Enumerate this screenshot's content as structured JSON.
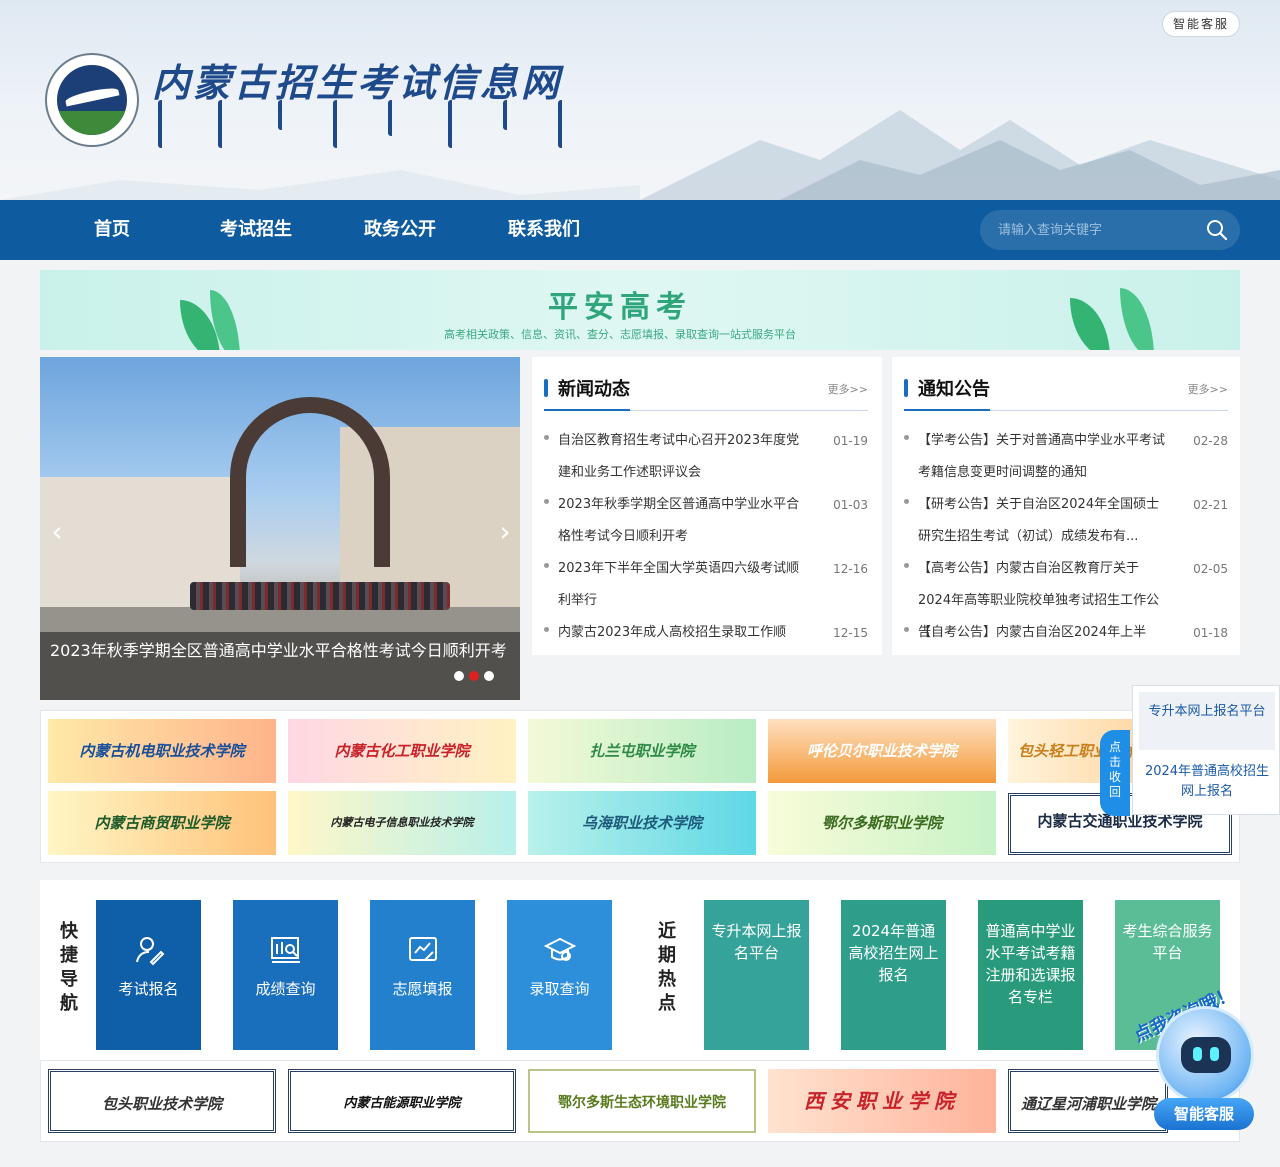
{
  "header": {
    "site_title": "内蒙古招生考试信息网",
    "service_button": "智能客服"
  },
  "nav": {
    "items": [
      {
        "label": "首页"
      },
      {
        "label": "考试招生"
      },
      {
        "label": "政务公开"
      },
      {
        "label": "联系我们"
      }
    ],
    "search_placeholder": "请输入查询关键字"
  },
  "banner": {
    "title": "平安高考",
    "subtitle": "高考相关政策、信息、资讯、查分、志愿填报、录取查询一站式服务平台"
  },
  "slider": {
    "caption": "2023年秋季学期全区普通高中学业水平合格性考试今日顺利开考",
    "prev": "‹",
    "next": "›",
    "active_dot": 2,
    "dot_count": 3
  },
  "news": {
    "title": "新闻动态",
    "more": "更多>>",
    "items": [
      {
        "text": "自治区教育招生考试中心召开2023年度党建和业务工作述职评议会",
        "date": "01-19"
      },
      {
        "text": "2023年秋季学期全区普通高中学业水平合格性考试今日顺利开考",
        "date": "01-03"
      },
      {
        "text": "2023年下半年全国大学英语四六级考试顺利举行",
        "date": "12-16"
      },
      {
        "text": "内蒙古2023年成人高校招生录取工作顺",
        "date": "12-15"
      }
    ]
  },
  "notices": {
    "title": "通知公告",
    "more": "更多>>",
    "items": [
      {
        "text": "【学考公告】关于对普通高中学业水平考试考籍信息变更时间调整的通知",
        "date": "02-28"
      },
      {
        "text": "【研考公告】关于自治区2024年全国硕士研究生招生考试（初试）成绩发布有...",
        "date": "02-21"
      },
      {
        "text": "【高考公告】内蒙古自治区教育厅关于2024年高等职业院校单独考试招生工作公告",
        "date": "02-05"
      },
      {
        "text": "【自考公告】内蒙古自治区2024年上半",
        "date": "01-18"
      }
    ]
  },
  "schools_row1": [
    {
      "name": "内蒙古机电职业技术学院",
      "color": "#1a4f9c"
    },
    {
      "name": "内蒙古化工职业学院",
      "color": "#c8222a"
    },
    {
      "name": "扎兰屯职业学院",
      "color": "#2f8a45"
    },
    {
      "name": "呼伦贝尔职业技术学院",
      "color": "#ffffff"
    },
    {
      "name": "包头轻工职业技术学院",
      "color": "#c9801e"
    }
  ],
  "schools_row2": [
    {
      "name": "内蒙古商贸职业学院",
      "color": "#1e5b2a"
    },
    {
      "name": "内蒙古电子信息职业技术学院",
      "color": "#222222"
    },
    {
      "name": "乌海职业技术学院",
      "color": "#1e5a7a"
    },
    {
      "name": "鄂尔多斯职业学院",
      "color": "#3a6b1e"
    },
    {
      "name": "内蒙古交通职业技术学院",
      "color": "#1a2a44"
    }
  ],
  "quick_nav": {
    "label": "快捷导航",
    "items": [
      {
        "label": "考试报名",
        "icon": "person-edit-icon"
      },
      {
        "label": "成绩查询",
        "icon": "score-search-icon"
      },
      {
        "label": "志愿填报",
        "icon": "chart-edit-icon"
      },
      {
        "label": "录取查询",
        "icon": "graduation-cap-icon"
      }
    ]
  },
  "hot": {
    "label": "近期热点",
    "items": [
      {
        "label": "专升本网上报名平台"
      },
      {
        "label": "2024年普通高校招生网上报名"
      },
      {
        "label": "普通高中学业水平考试考籍注册和选课报名专栏"
      },
      {
        "label": "考生综合服务平台"
      }
    ]
  },
  "schools_row3": [
    {
      "name": "包头职业技术学院",
      "color": "#333333"
    },
    {
      "name": "内蒙古能源职业学院",
      "color": "#111111"
    },
    {
      "name": "鄂尔多斯生态环境职业学院",
      "color": "#5a7a1e"
    },
    {
      "name": "西安职业学院",
      "color": "#c8222a"
    },
    {
      "name": "通辽星河浦职业学院",
      "color": "#333333"
    }
  ],
  "float_panel": {
    "link1": "专升本网上报名平台",
    "link2": "2024年普通高校招生网上报名",
    "collapse_tab": "点击收回"
  },
  "robot": {
    "bubble": "点我咨询哦！",
    "label": "智能客服"
  },
  "colors": {
    "nav_bg": "#0f5b9f",
    "accent": "#1a6ec2",
    "banner_green": "#2fa57b"
  }
}
